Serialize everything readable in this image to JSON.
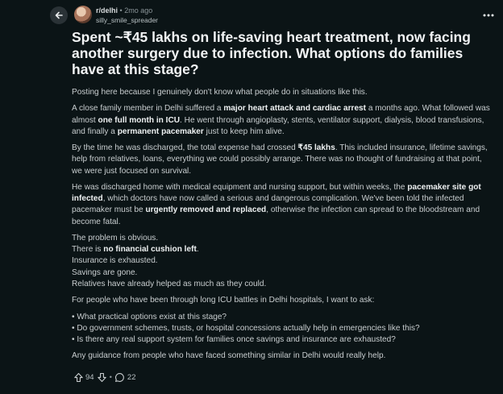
{
  "header": {
    "subreddit": "r/delhi",
    "separator": "•",
    "time": "2mo ago",
    "username": "silly_smile_spreader"
  },
  "post": {
    "title": "Spent ~₹45 lakhs on life-saving heart treatment, now facing another surgery due to infection. What options do families have at this stage?",
    "intro": "Posting here because I genuinely don't know what people do in situations like this.",
    "p2": {
      "a": "A close family member in Delhi suffered a ",
      "b1": "major heart attack and cardiac arrest",
      "c": " a months ago. What followed was almost ",
      "b2": "one full month in ICU",
      "d": ". He went through angioplasty, stents, ventilator support, dialysis, blood transfusions, and finally a ",
      "b3": "permanent pacemaker",
      "e": " just to keep him alive."
    },
    "p3": {
      "a": "By the time he was discharged, the total expense had crossed ",
      "b1": "₹45 lakhs",
      "c": ". This included insurance, lifetime savings, help from relatives, loans, everything we could possibly arrange. There was no thought of fundraising at that point, we were just focused on survival."
    },
    "p4": {
      "a": "He was discharged home with medical equipment and nursing support, but within weeks, the ",
      "b1": "pacemaker site got infected",
      "c": ", which doctors have now called a serious and dangerous complication. We've been told the infected pacemaker must be ",
      "b2": "urgently removed and replaced",
      "d": ", otherwise the infection can spread to the bloodstream and become fatal."
    },
    "p5": {
      "l1": "The problem is obvious.",
      "l2a": "There is ",
      "l2b": "no financial cushion left",
      "l2c": ".",
      "l3": "Insurance is exhausted.",
      "l4": "Savings are gone.",
      "l5": "Relatives have already helped as much as they could."
    },
    "p6": "For people who have been through long ICU battles in Delhi hospitals, I want to ask:",
    "questions": [
      "• What practical options exist at this stage?",
      "• Do government schemes, trusts, or hospital concessions actually help in emergencies like this?",
      "• Is there any real support system for families once savings and insurance are exhausted?"
    ],
    "closing": "Any guidance from people who have faced something similar in Delhi would really help."
  },
  "actions": {
    "upvotes": "94",
    "separator": "•",
    "comments": "22"
  },
  "icons": {
    "back": "arrow-left-icon",
    "more": "ellipsis-icon",
    "upvote": "arrow-up-icon",
    "downvote": "arrow-down-icon",
    "comment": "speech-bubble-icon"
  }
}
